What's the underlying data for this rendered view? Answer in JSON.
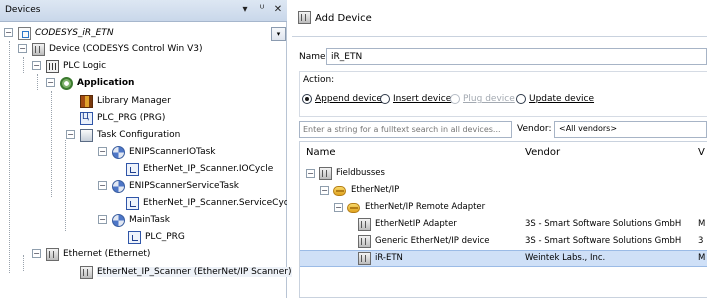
{
  "devices_panel": {
    "title": "Devices",
    "buttons": {
      "dropdown": "▾",
      "pin": "ᵁ",
      "close": "✕"
    },
    "root_dropdown": "▾",
    "tree": [
      {
        "label": "CODESYS_iR_ETN",
        "icon": "project-icon",
        "style": "italic",
        "toggle": "−"
      },
      {
        "label": "Device (CODESYS Control Win V3)",
        "icon": "device-icon",
        "toggle": "−"
      },
      {
        "label": "PLC Logic",
        "icon": "plc-logic-icon",
        "toggle": "−"
      },
      {
        "label": "Application",
        "icon": "application-icon",
        "style": "bold",
        "toggle": "−"
      },
      {
        "label": "Library Manager",
        "icon": "library-manager-icon"
      },
      {
        "label": "PLC_PRG (PRG)",
        "icon": "pou-icon"
      },
      {
        "label": "Task Configuration",
        "icon": "task-configuration-icon",
        "toggle": "−"
      },
      {
        "label": "ENIPScannerIOTask",
        "icon": "task-icon",
        "toggle": "−"
      },
      {
        "label": "EtherNet_IP_Scanner.IOCycle",
        "icon": "program-call-icon"
      },
      {
        "label": "ENIPScannerServiceTask",
        "icon": "task-icon",
        "toggle": "−"
      },
      {
        "label": "EtherNet_IP_Scanner.ServiceCyc",
        "icon": "program-call-icon"
      },
      {
        "label": "MainTask",
        "icon": "task-icon",
        "toggle": "−"
      },
      {
        "label": "PLC_PRG",
        "icon": "program-call-icon"
      },
      {
        "label": "Ethernet (Ethernet)",
        "icon": "device-icon",
        "toggle": "−"
      },
      {
        "label": "EtherNet_IP_Scanner (EtherNet/IP Scanner)",
        "icon": "device-icon",
        "style": "selected"
      }
    ]
  },
  "add_device": {
    "title": "Add Device",
    "name_label": "Name:",
    "name_value": "iR_ETN",
    "action_label": "Action:",
    "actions": [
      {
        "label": "Append device",
        "checked": true,
        "disabled": false
      },
      {
        "label": "Insert device",
        "checked": false,
        "disabled": false
      },
      {
        "label": "Plug device",
        "checked": false,
        "disabled": true
      },
      {
        "label": "Update device",
        "checked": false,
        "disabled": false
      }
    ],
    "search_placeholder": "Enter a string for a fulltext search in all devices...",
    "vendor_label": "Vendor:",
    "vendor_value": "<All vendors>",
    "columns": {
      "name": "Name",
      "vendor": "Vendor",
      "version": "V"
    },
    "rows": [
      {
        "name": "Fieldbusses",
        "vendor": "",
        "version": "",
        "icon": "fieldbus-icon",
        "toggle": "−"
      },
      {
        "name": "EtherNet/IP",
        "vendor": "",
        "version": "",
        "icon": "folder-icon",
        "toggle": "−"
      },
      {
        "name": "EtherNet/IP Remote Adapter",
        "vendor": "",
        "version": "",
        "icon": "folder-icon",
        "toggle": "−"
      },
      {
        "name": "EtherNetIP Adapter",
        "vendor": "3S - Smart Software Solutions GmbH",
        "version": "M",
        "icon": "device-icon"
      },
      {
        "name": "Generic EtherNet/IP device",
        "vendor": "3S - Smart Software Solutions GmbH",
        "version": "3",
        "icon": "device-icon"
      },
      {
        "name": "iR-ETN",
        "vendor": "Weintek Labs., Inc.",
        "version": "M",
        "icon": "device-icon",
        "selected": true
      }
    ]
  }
}
